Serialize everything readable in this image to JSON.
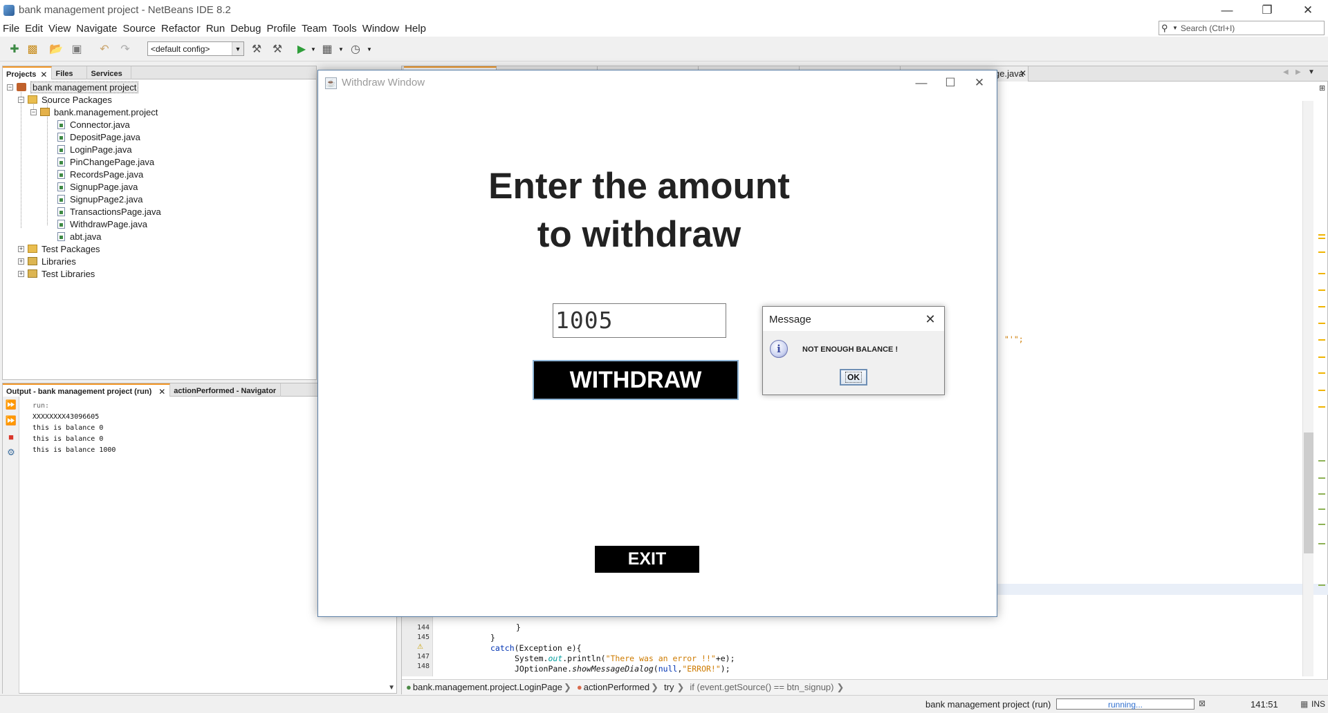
{
  "ide": {
    "title": "bank management project - NetBeans IDE 8.2",
    "menu": [
      "File",
      "Edit",
      "View",
      "Navigate",
      "Source",
      "Refactor",
      "Run",
      "Debug",
      "Profile",
      "Team",
      "Tools",
      "Window",
      "Help"
    ],
    "search_placeholder": "Search (Ctrl+I)",
    "config": "<default config>"
  },
  "projects_panel": {
    "tabs": [
      "Projects",
      "Files",
      "Services"
    ],
    "tree": {
      "project": "bank management project",
      "source_packages": "Source Packages",
      "package": "bank.management.project",
      "files": [
        "Connector.java",
        "DepositPage.java",
        "LoginPage.java",
        "PinChangePage.java",
        "RecordsPage.java",
        "SignupPage.java",
        "SignupPage2.java",
        "TransactionsPage.java",
        "WithdrawPage.java",
        "abt.java"
      ],
      "test_packages": "Test Packages",
      "libraries": "Libraries",
      "test_libraries": "Test Libraries"
    }
  },
  "output_panel": {
    "tabs": [
      "Output - bank management project (run)",
      "actionPerformed - Navigator"
    ],
    "lines": [
      "run:",
      "XXXXXXXX43096605",
      "this is balance 0",
      "this is balance 0",
      "this is balance 1000"
    ]
  },
  "editor": {
    "visible_tab": "ge.java",
    "fragment": "\"'\";",
    "line_numbers": [
      "144",
      "145",
      "",
      "147",
      "148"
    ],
    "breadcrumb": [
      "bank.management.project.LoginPage",
      "actionPerformed",
      "try",
      "if (event.getSource() == btn_signup)"
    ]
  },
  "status": {
    "project": "bank management project (run)",
    "progress_label": "running...",
    "cursor": "141:51",
    "mode": "INS"
  },
  "withdraw_window": {
    "title": "Withdraw Window",
    "heading_line1": "Enter the amount",
    "heading_line2": "to withdraw",
    "amount_value": "1005",
    "withdraw_label": "WITHDRAW",
    "exit_label": "EXIT"
  },
  "message_dialog": {
    "title": "Message",
    "message": "NOT ENOUGH BALANCE !",
    "ok_label": "OK"
  }
}
